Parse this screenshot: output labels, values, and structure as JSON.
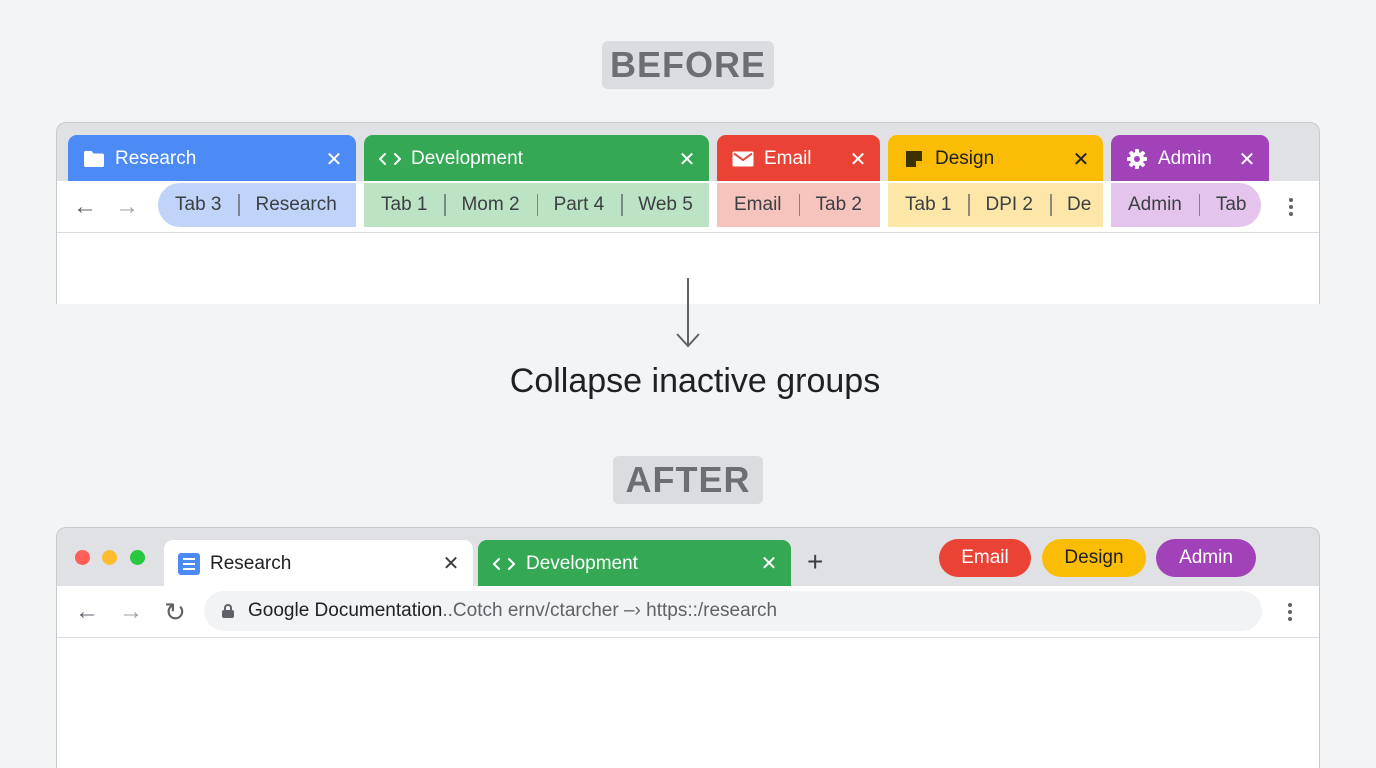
{
  "before": {
    "label": "BEFORE",
    "groups": [
      {
        "name": "Research",
        "color": "#4c8bf5",
        "icon": "folder-icon",
        "tabs": [
          "Tab 3",
          "Research"
        ]
      },
      {
        "name": "Development",
        "color": "#34a853",
        "icon": "code-icon",
        "tabs": [
          "Tab 1",
          "Mom 2",
          "Part 4",
          "Web 5"
        ]
      },
      {
        "name": "Email",
        "color": "#ea4335",
        "icon": "mail-icon",
        "tabs": [
          "Email",
          "Tab 2"
        ]
      },
      {
        "name": "Design",
        "color": "#fbbc05",
        "icon": "sticky-note-icon",
        "tabs": [
          "Tab 1",
          "DPI 2",
          "De"
        ]
      },
      {
        "name": "Admin",
        "color": "#a142b8",
        "icon": "gear-icon",
        "tabs": [
          "Admin",
          "Tab"
        ]
      }
    ],
    "close_glyph": "✕"
  },
  "action": {
    "caption": "Collapse inactive groups"
  },
  "after": {
    "label": "AFTER",
    "active_tab": {
      "name": "Research",
      "icon": "document-icon"
    },
    "group_tab": {
      "name": "Development",
      "color": "#34a853",
      "icon": "code-icon"
    },
    "new_tab_glyph": "+",
    "collapsed_groups": [
      {
        "name": "Email",
        "color": "#ea4335"
      },
      {
        "name": "Design",
        "color": "#fbbc05"
      },
      {
        "name": "Admin",
        "color": "#a142b8"
      }
    ],
    "omnibox": {
      "title": "Google  Documentation",
      "url": "..Cotch ernv/ctarcher –› https::/research"
    },
    "close_glyph": "✕"
  },
  "glyphs": {
    "back": "←",
    "forward": "→",
    "reload": "↻"
  }
}
